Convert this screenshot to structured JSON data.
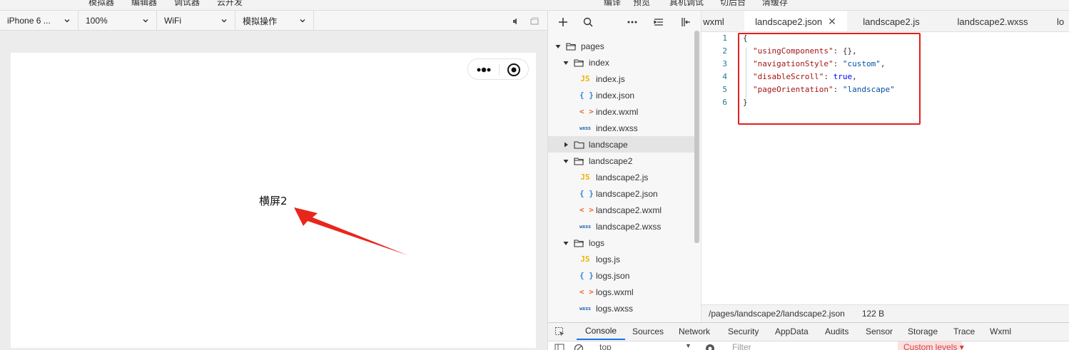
{
  "top_menu": [
    "模拟器",
    "编辑器",
    "调试器",
    "云开发",
    "编译",
    "预览",
    "真机调试",
    "切后台",
    "清缓存"
  ],
  "simulator": {
    "device": "iPhone 6 ...",
    "zoom": "100%",
    "network": "WiFi",
    "operation": "模拟操作",
    "page_text": "横屏2"
  },
  "tree": {
    "items": [
      {
        "label": "pages",
        "type": "folder"
      },
      {
        "label": "index",
        "type": "folder"
      },
      {
        "label": "index.js",
        "type": "js",
        "icon": "JS"
      },
      {
        "label": "index.json",
        "type": "json",
        "icon": "{ }"
      },
      {
        "label": "index.wxml",
        "type": "wxml",
        "icon": "< >"
      },
      {
        "label": "index.wxss",
        "type": "wxss",
        "icon": "wxss"
      },
      {
        "label": "landscape",
        "type": "folder"
      },
      {
        "label": "landscape2",
        "type": "folder"
      },
      {
        "label": "landscape2.js",
        "type": "js",
        "icon": "JS"
      },
      {
        "label": "landscape2.json",
        "type": "json",
        "icon": "{ }"
      },
      {
        "label": "landscape2.wxml",
        "type": "wxml",
        "icon": "< >"
      },
      {
        "label": "landscape2.wxss",
        "type": "wxss",
        "icon": "wxss"
      },
      {
        "label": "logs",
        "type": "folder"
      },
      {
        "label": "logs.js",
        "type": "js",
        "icon": "JS"
      },
      {
        "label": "logs.json",
        "type": "json",
        "icon": "{ }"
      },
      {
        "label": "logs.wxml",
        "type": "wxml",
        "icon": "< >"
      },
      {
        "label": "logs.wxss",
        "type": "wxss",
        "icon": "wxss"
      }
    ]
  },
  "editor": {
    "tabs": [
      "wxml",
      "landscape2.json",
      "landscape2.js",
      "landscape2.wxss",
      "lo"
    ],
    "active_tab": "landscape2.json",
    "line_numbers": [
      "1",
      "2",
      "3",
      "4",
      "5",
      "6"
    ],
    "code": {
      "open": "{",
      "k1": "\"usingComponents\"",
      "v1": "{}",
      "k2": "\"navigationStyle\"",
      "v2": "\"custom\"",
      "k3": "\"disableScroll\"",
      "v3": "true",
      "k4": "\"pageOrientation\"",
      "v4": "\"landscape\"",
      "close": "}",
      "colon": ": ",
      "comma": ","
    },
    "status_path": "/pages/landscape2/landscape2.json",
    "status_size": "122 B"
  },
  "devtools": {
    "tabs": [
      "Console",
      "Sources",
      "Network",
      "Security",
      "AppData",
      "Audits",
      "Sensor",
      "Storage",
      "Trace",
      "Wxml"
    ],
    "active_tab": "Console",
    "context": "top",
    "filter_placeholder": "Filter",
    "levels": "Custom levels ▾"
  },
  "colors": {
    "highlight": "#e02020",
    "arrow": "#e8261c",
    "accent": "#1a73e8"
  }
}
